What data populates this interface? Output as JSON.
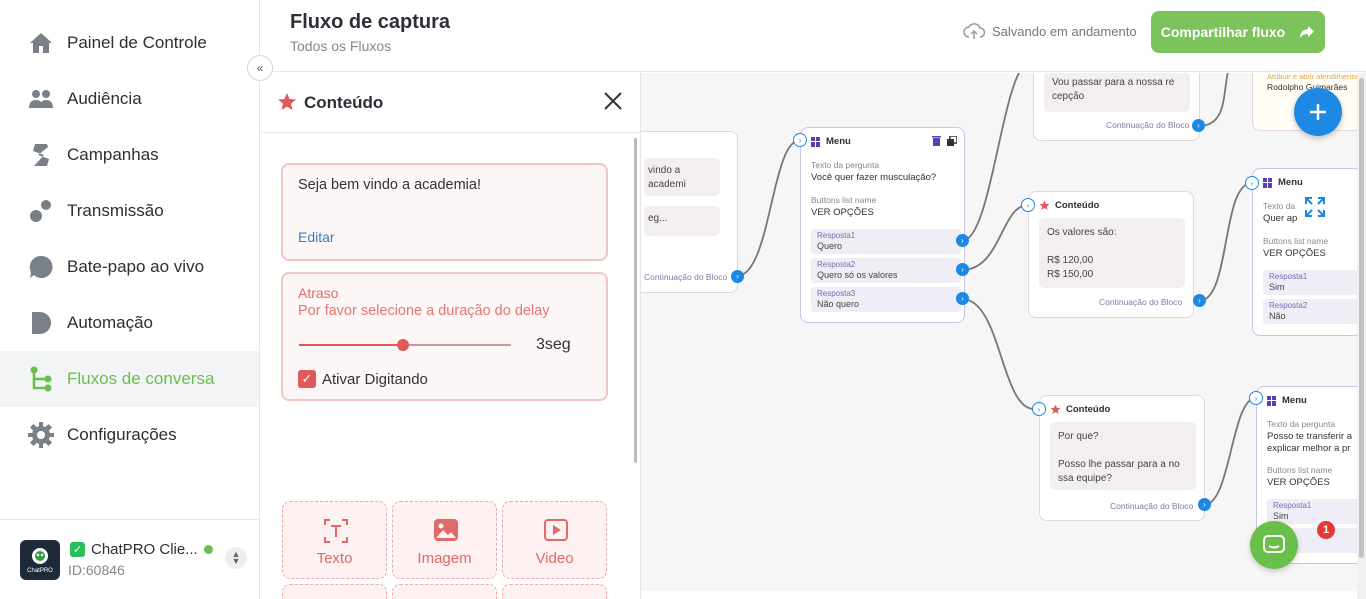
{
  "sidebar": {
    "items": [
      {
        "label": "Painel de Controle",
        "icon": "home-icon"
      },
      {
        "label": "Audiência",
        "icon": "users-icon"
      },
      {
        "label": "Campanhas",
        "icon": "campaign-icon"
      },
      {
        "label": "Transmissão",
        "icon": "broadcast-icon"
      },
      {
        "label": "Bate-papo ao vivo",
        "icon": "chat-bubble-icon"
      },
      {
        "label": "Automação",
        "icon": "automation-icon"
      },
      {
        "label": "Fluxos de conversa",
        "icon": "flow-icon"
      },
      {
        "label": "Configurações",
        "icon": "gear-icon"
      }
    ],
    "active": "Fluxos de conversa",
    "account": {
      "name": "ChatPRO Clie...",
      "id": "ID:60846",
      "logo_text": "ChatPRO"
    }
  },
  "header": {
    "title": "Fluxo de captura",
    "breadcrumb": "Todos os Fluxos",
    "saving": "Salvando em andamento",
    "share_label": "Compartilhar fluxo"
  },
  "panel": {
    "title": "Conteúdo",
    "message": "Seja bem vindo a academia!",
    "edit_label": "Editar",
    "delay_title": "Atraso",
    "delay_subtitle": "Por favor selecione a duração do delay",
    "delay_value": "3seg",
    "delay_fraction": 0.49,
    "typing_label": "Ativar Digitando",
    "typing_checked": true,
    "add_buttons": [
      "Texto",
      "Imagem",
      "Video"
    ]
  },
  "canvas": {
    "node_partial": {
      "line1": "vindo a academi",
      "line2": "eg...",
      "continuation": "Continuação do Bloco"
    },
    "menu1": {
      "title": "Menu",
      "question_label": "Texto da pergunta",
      "question": "Você quer fazer musculação?",
      "list_label": "Buttons list name",
      "list_name": "VER OPÇÕES",
      "responses": [
        {
          "label": "Resposta1",
          "value": "Quero"
        },
        {
          "label": "Resposta2",
          "value": "Quero só os valores"
        },
        {
          "label": "Resposta3",
          "value": "Não quero"
        }
      ]
    },
    "top_node": {
      "text1": "Vou passar para a nossa re",
      "text2": "cepção",
      "continuation": "Continuação do Bloco"
    },
    "top_right": {
      "line1": "Atribuir e abrir atendimento",
      "line2": "Rodolpho Guimarães"
    },
    "content1": {
      "title": "Conteúdo",
      "line1": "Os valores são:",
      "line2": "R$ 120,00",
      "line3": "R$ 150,00",
      "continuation": "Continuação do Bloco"
    },
    "menu2": {
      "title": "Menu",
      "question_label": "Texto da",
      "question": "Quer ap   agor",
      "list_label": "Buttons list name",
      "list_name": "VER OPÇÕES",
      "responses": [
        {
          "label": "Resposta1",
          "value": "Sim"
        },
        {
          "label": "Resposta2",
          "value": "Não"
        }
      ]
    },
    "content2": {
      "title": "Conteúdo",
      "line1": "Por que?",
      "line2": "Posso lhe passar para a no",
      "line3": "ssa equipe?",
      "continuation": "Continuação do Bloco"
    },
    "menu3": {
      "title": "Menu",
      "question_label": "Texto da pergunta",
      "question1": "Posso te transferir a",
      "question2": "explicar melhor a pr",
      "list_label": "Buttons list name",
      "list_name": "VER OPÇÕES",
      "responses": [
        {
          "label": "Resposta1",
          "value": "Sim"
        },
        {
          "label": "Re",
          "value": "N"
        }
      ]
    },
    "chat_badge": "1"
  },
  "colors": {
    "brand_green": "#7cc35b",
    "accent_red": "#e05a5a",
    "port_blue": "#1e88e5"
  }
}
